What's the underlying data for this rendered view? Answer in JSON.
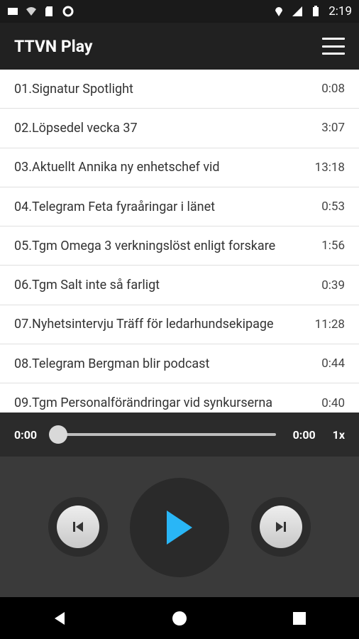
{
  "status": {
    "time": "2:19"
  },
  "appbar": {
    "title": "TTVN Play"
  },
  "tracks": [
    {
      "name": "01.Signatur Spotlight",
      "duration": "0:08"
    },
    {
      "name": "02.Löpsedel vecka 37",
      "duration": "3:07"
    },
    {
      "name": "03.Aktuellt Annika ny enhetschef vid",
      "duration": "13:18"
    },
    {
      "name": "04.Telegram Feta fyraåringar i länet",
      "duration": "0:53"
    },
    {
      "name": "05.Tgm Omega 3 verkningslöst enligt forskare",
      "duration": "1:56"
    },
    {
      "name": "06.Tgm Salt inte så farligt",
      "duration": "0:39"
    },
    {
      "name": "07.Nyhetsintervju Träff för ledarhundsekipage",
      "duration": "11:28"
    },
    {
      "name": "08.Telegram Bergman blir podcast",
      "duration": "0:44"
    },
    {
      "name": "09.Tgm Personalförändringar vid synkurserna",
      "duration": "0:40"
    }
  ],
  "player": {
    "elapsed": "0:00",
    "total": "0:00",
    "speed": "1x",
    "progress": 0
  },
  "colors": {
    "accent": "#29b6f6"
  }
}
